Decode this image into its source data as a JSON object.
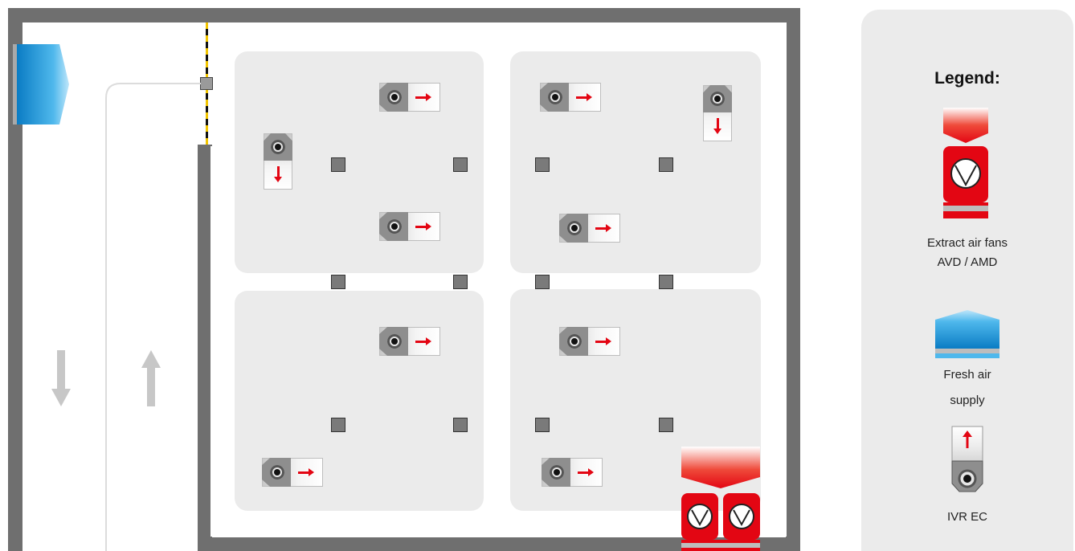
{
  "legend": {
    "title": "Legend:",
    "extract_fans_line1": "Extract air fans",
    "extract_fans_line2": "AVD / AMD",
    "fresh_air_line1": "Fresh air",
    "fresh_air_line2": "supply",
    "ivr_label": "IVR EC"
  },
  "colors": {
    "extract_red": "#e30613",
    "wall_gray": "#6f6f6f",
    "zone_gray": "#ebebeb",
    "fresh_air_blue": "#2aa0e0"
  },
  "icons": [
    "extract-fan-icon",
    "fresh-air-supply-icon",
    "jet-fan-icon",
    "pillar",
    "flow-arrow"
  ]
}
